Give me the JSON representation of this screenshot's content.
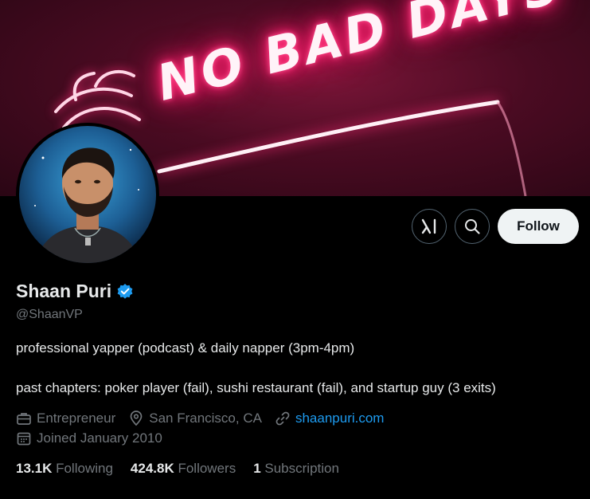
{
  "banner": {
    "neon_text": "NO BAD DAYS"
  },
  "profile": {
    "name": "Shaan Puri",
    "handle": "@ShaanVP",
    "bio_line_1": "professional yapper (podcast) & daily napper (3pm-4pm)",
    "bio_line_2": "past chapters: poker player (fail), sushi restaurant (fail), and startup guy (3 exits)",
    "category": "Entrepreneur",
    "location": "San Francisco, CA",
    "website": "shaanpuri.com",
    "joined": "Joined January 2010"
  },
  "actions": {
    "grok_icon": "grok-icon",
    "search_icon": "search-icon",
    "follow_label": "Follow"
  },
  "stats": {
    "following_count": "13.1K",
    "following_label": "Following",
    "followers_count": "424.8K",
    "followers_label": "Followers",
    "subscriptions_count": "1",
    "subscriptions_label": "Subscription"
  },
  "colors": {
    "background": "#000000",
    "accent_link": "#1d9bf0",
    "verified": "#1d9bf0",
    "muted_text": "#71767b",
    "follow_button_bg": "#eff3f4"
  }
}
